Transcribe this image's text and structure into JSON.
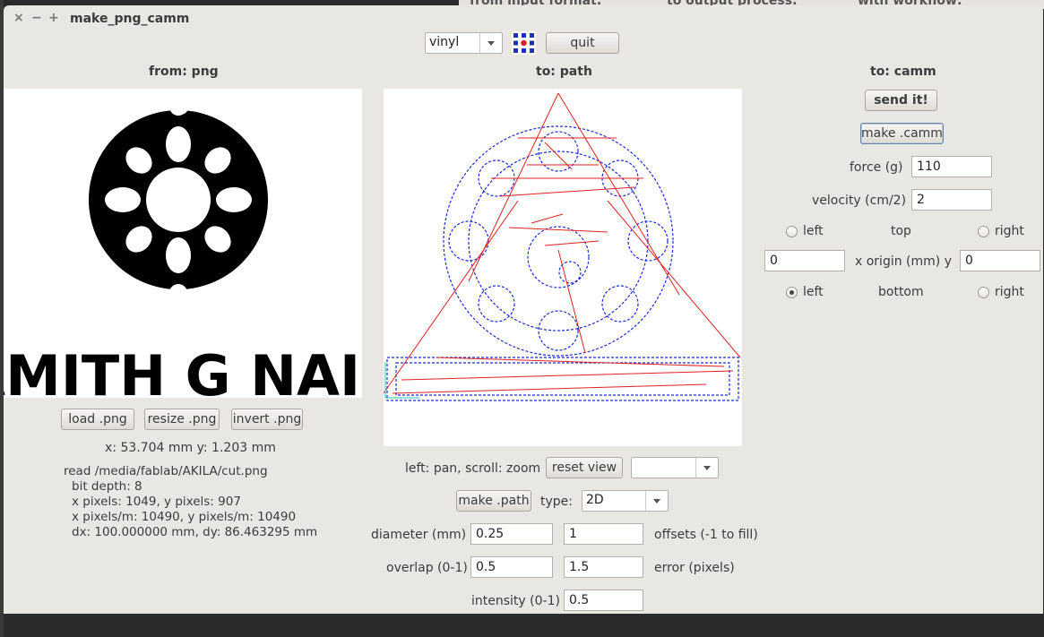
{
  "background": {
    "texts": [
      "from input format:",
      "to output process:",
      "with workflow:"
    ]
  },
  "window": {
    "title": "make_png_camm",
    "controls": [
      "×",
      "−",
      "+"
    ]
  },
  "toolbar": {
    "machine_select": "vinyl",
    "quit_label": "quit"
  },
  "from_panel": {
    "header": "from: png",
    "image_text": "AMITH G NAIR",
    "load_label": "load .png",
    "resize_label": "resize .png",
    "invert_label": "invert .png",
    "coords": "x: 53.704 mm  y: 1.203 mm",
    "info_lines": [
      "read /media/fablab/AKILA/cut.png",
      "bit depth: 8",
      "x pixels: 1049, y pixels: 907",
      "x pixels/m: 10490, y pixels/m: 10490",
      "dx: 100.000000 mm, dy: 86.463295 mm"
    ]
  },
  "path_panel": {
    "header": "to: path",
    "pan_hint": "left: pan, scroll: zoom",
    "reset_view_label": "reset view",
    "view_select": "",
    "make_path_label": "make .path",
    "type_label": "type:",
    "type_value": "2D",
    "diameter_label": "diameter (mm)",
    "diameter_value": "0.25",
    "offsets_value": "1",
    "offsets_label": "offsets (-1 to fill)",
    "overlap_label": "overlap (0-1)",
    "overlap_value": "0.5",
    "error_value": "1.5",
    "error_label": "error (pixels)",
    "intensity_label": "intensity (0-1)",
    "intensity_value": "0.5",
    "colors": {
      "path": "#1a2bd8",
      "move": "#e02020"
    }
  },
  "camm_panel": {
    "header": "to: camm",
    "send_label": "send it!",
    "make_camm_label": "make .camm",
    "force_label": "force (g)",
    "force_value": "110",
    "velocity_label": "velocity (cm/2)",
    "velocity_value": "2",
    "top_left_label": "left",
    "top_label": "top",
    "top_right_label": "right",
    "origin_x_value": "0",
    "origin_label": "x  origin (mm)  y",
    "origin_y_value": "0",
    "bottom_left_label": "left",
    "bottom_label": "bottom",
    "bottom_right_label": "right",
    "selected_origin": "bottom-left"
  }
}
